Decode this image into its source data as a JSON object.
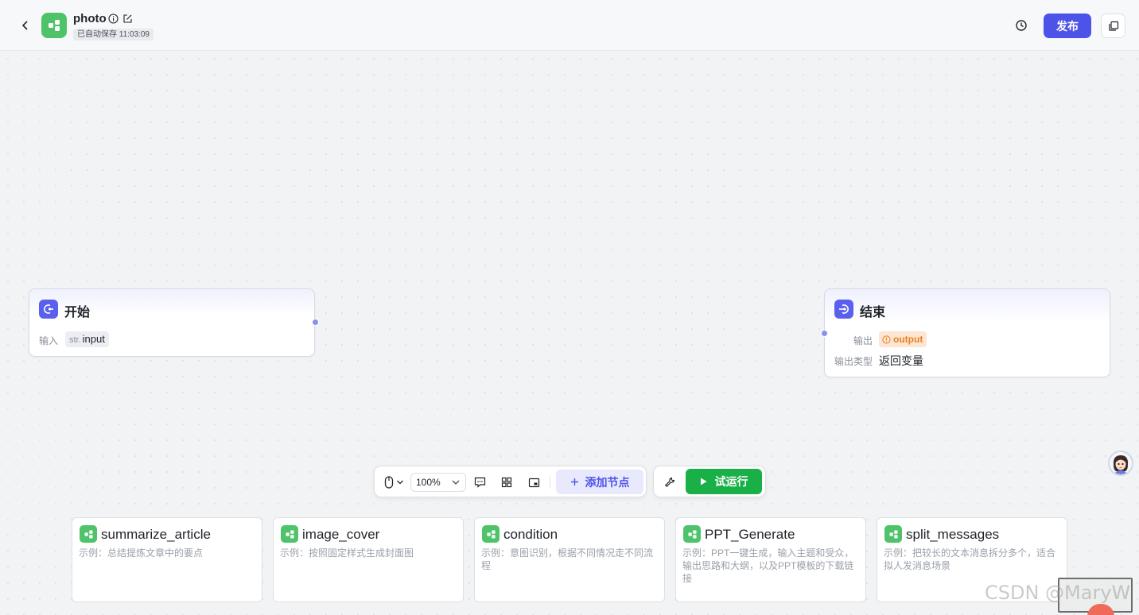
{
  "header": {
    "app_name": "photo",
    "save_status": "已自动保存 11:03:09",
    "publish_label": "发布"
  },
  "colors": {
    "accent": "#4d53e8",
    "run_green": "#1ab048",
    "app_logo_green": "#4fc36a",
    "node_icon_purple": "#5a60ed",
    "output_orange": "#e8801e"
  },
  "icons": {
    "back": "chevron-left-icon",
    "info": "info-icon",
    "edit": "edit-icon",
    "history": "history-icon",
    "copy": "copy-icon",
    "mouse": "mouse-icon",
    "comment": "comment-icon",
    "layout": "grid-layout-icon",
    "minimap": "minimap-icon",
    "plus": "plus-icon",
    "wrench": "wrench-icon",
    "play": "play-icon"
  },
  "nodes": {
    "start": {
      "title": "开始",
      "input_label": "输入",
      "input_type": "str.",
      "input_name": "input"
    },
    "end": {
      "title": "结束",
      "output_label": "输出",
      "output_var": "output",
      "output_type_label": "输出类型",
      "output_type_value": "返回变量"
    }
  },
  "toolbar": {
    "zoom": "100%",
    "add_node_label": "添加节点",
    "run_label": "试运行"
  },
  "templates": [
    {
      "title": "summarize_article",
      "desc": "示例：总结提炼文章中的要点"
    },
    {
      "title": "image_cover",
      "desc": "示例：按照固定样式生成封面图"
    },
    {
      "title": "condition",
      "desc": "示例：意图识别，根据不同情况走不同流程"
    },
    {
      "title": "PPT_Generate",
      "desc": "示例：PPT一键生成，输入主题和受众，输出思路和大纲，以及PPT模板的下载链接"
    },
    {
      "title": "split_messages",
      "desc": "示例：把较长的文本消息拆分多个，适合拟人发消息场景"
    }
  ],
  "watermark": "CSDN @MaryW"
}
